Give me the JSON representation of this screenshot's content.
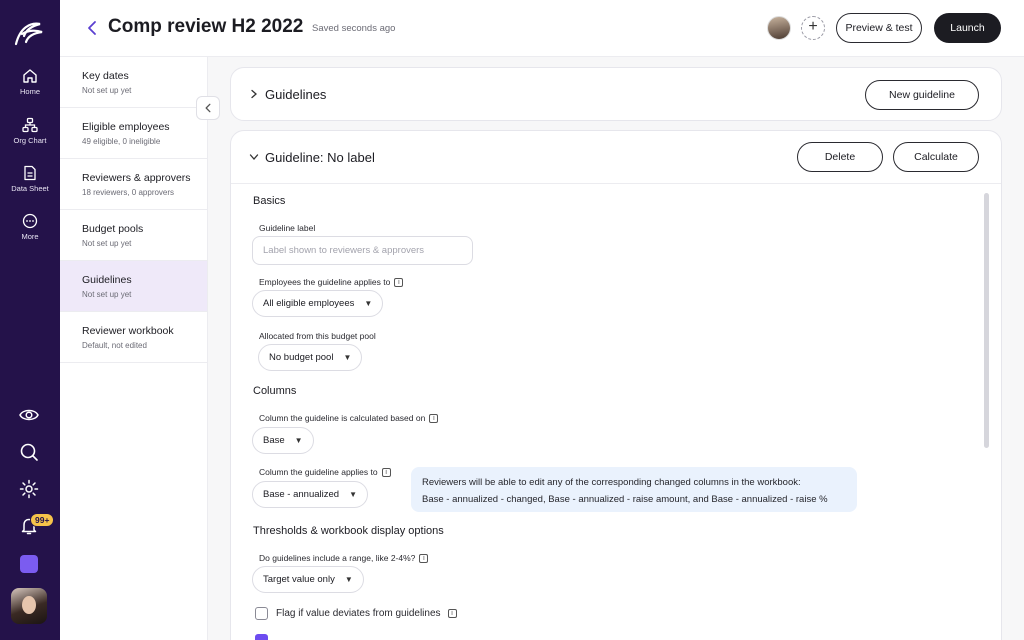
{
  "rail": {
    "items": [
      {
        "label": "Home"
      },
      {
        "label": "Org Chart"
      },
      {
        "label": "Data Sheet"
      },
      {
        "label": "More"
      }
    ],
    "notifications_badge": "99+"
  },
  "header": {
    "title": "Comp review H2 2022",
    "saved_status": "Saved seconds ago",
    "preview_label": "Preview & test",
    "launch_label": "Launch"
  },
  "steps": [
    {
      "title": "Key dates",
      "subtitle": "Not set up yet"
    },
    {
      "title": "Eligible employees",
      "subtitle": "49 eligible, 0 ineligible"
    },
    {
      "title": "Reviewers & approvers",
      "subtitle": "18 reviewers, 0 approvers"
    },
    {
      "title": "Budget pools",
      "subtitle": "Not set up yet"
    },
    {
      "title": "Guidelines",
      "subtitle": "Not set up yet"
    },
    {
      "title": "Reviewer workbook",
      "subtitle": "Default, not edited"
    }
  ],
  "guidelines_card": {
    "title": "Guidelines",
    "new_button": "New guideline"
  },
  "guideline": {
    "title": "Guideline: No label",
    "delete_label": "Delete",
    "calculate_label": "Calculate",
    "basics": {
      "heading": "Basics",
      "label_field": {
        "label": "Guideline label",
        "value": "",
        "placeholder": "Label shown to reviewers & approvers"
      },
      "applies_to": {
        "label": "Employees the guideline applies to",
        "value": "All eligible employees"
      },
      "budget_pool": {
        "label": "Allocated from this budget pool",
        "value": "No budget pool"
      }
    },
    "columns": {
      "heading": "Columns",
      "calculated_on": {
        "label": "Column the guideline is calculated based on",
        "value": "Base"
      },
      "applies_to_column": {
        "label": "Column the guideline applies to",
        "value": "Base - annualized"
      },
      "notice_line1": "Reviewers will be able to edit any of the corresponding changed columns in the workbook:",
      "notice_line2": "Base - annualized - changed, Base - annualized - raise amount, and Base - annualized - raise %"
    },
    "thresholds": {
      "heading": "Thresholds & workbook display options",
      "range": {
        "label": "Do guidelines include a range, like 2-4%?",
        "value": "Target value only"
      },
      "flag_label": "Flag if value deviates from guidelines",
      "flag_checked": false
    }
  },
  "colors": {
    "rail_bg": "#24124a",
    "accent": "#6d4cf0",
    "active_step_bg": "#efe9f9",
    "notice_bg": "#eaf2fd",
    "dark_button": "#1c1c22"
  }
}
